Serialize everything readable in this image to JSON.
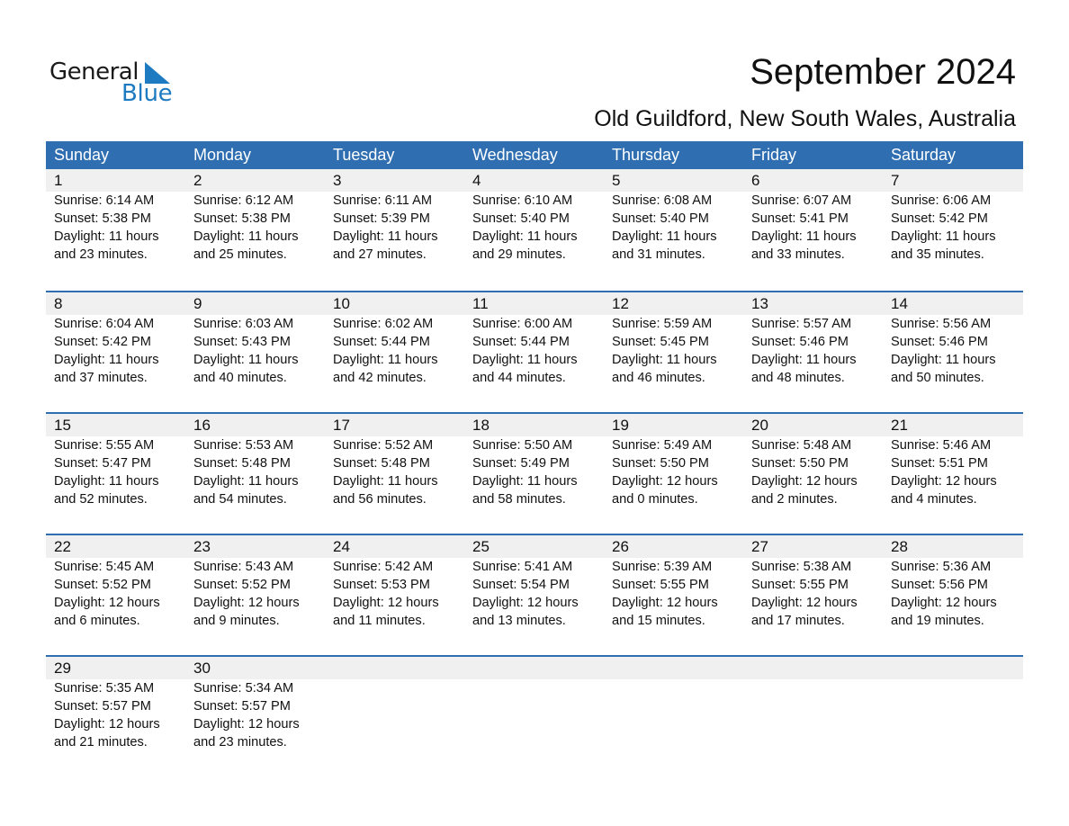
{
  "logo": {
    "word1": "General",
    "word2": "Blue",
    "icon": "triangle-flag-icon",
    "brand_color": "#1f7bc1"
  },
  "header": {
    "title": "September 2024",
    "location": "Old Guildford, New South Wales, Australia"
  },
  "colors": {
    "header_bg": "#2e6eb1",
    "date_strip_bg": "#f0f0f0"
  },
  "weekdays": [
    "Sunday",
    "Monday",
    "Tuesday",
    "Wednesday",
    "Thursday",
    "Friday",
    "Saturday"
  ],
  "weeks": [
    [
      {
        "day": "1",
        "sunrise": "Sunrise: 6:14 AM",
        "sunset": "Sunset: 5:38 PM",
        "daylight": "Daylight: 11 hours",
        "minutes": "and 23 minutes."
      },
      {
        "day": "2",
        "sunrise": "Sunrise: 6:12 AM",
        "sunset": "Sunset: 5:38 PM",
        "daylight": "Daylight: 11 hours",
        "minutes": "and 25 minutes."
      },
      {
        "day": "3",
        "sunrise": "Sunrise: 6:11 AM",
        "sunset": "Sunset: 5:39 PM",
        "daylight": "Daylight: 11 hours",
        "minutes": "and 27 minutes."
      },
      {
        "day": "4",
        "sunrise": "Sunrise: 6:10 AM",
        "sunset": "Sunset: 5:40 PM",
        "daylight": "Daylight: 11 hours",
        "minutes": "and 29 minutes."
      },
      {
        "day": "5",
        "sunrise": "Sunrise: 6:08 AM",
        "sunset": "Sunset: 5:40 PM",
        "daylight": "Daylight: 11 hours",
        "minutes": "and 31 minutes."
      },
      {
        "day": "6",
        "sunrise": "Sunrise: 6:07 AM",
        "sunset": "Sunset: 5:41 PM",
        "daylight": "Daylight: 11 hours",
        "minutes": "and 33 minutes."
      },
      {
        "day": "7",
        "sunrise": "Sunrise: 6:06 AM",
        "sunset": "Sunset: 5:42 PM",
        "daylight": "Daylight: 11 hours",
        "minutes": "and 35 minutes."
      }
    ],
    [
      {
        "day": "8",
        "sunrise": "Sunrise: 6:04 AM",
        "sunset": "Sunset: 5:42 PM",
        "daylight": "Daylight: 11 hours",
        "minutes": "and 37 minutes."
      },
      {
        "day": "9",
        "sunrise": "Sunrise: 6:03 AM",
        "sunset": "Sunset: 5:43 PM",
        "daylight": "Daylight: 11 hours",
        "minutes": "and 40 minutes."
      },
      {
        "day": "10",
        "sunrise": "Sunrise: 6:02 AM",
        "sunset": "Sunset: 5:44 PM",
        "daylight": "Daylight: 11 hours",
        "minutes": "and 42 minutes."
      },
      {
        "day": "11",
        "sunrise": "Sunrise: 6:00 AM",
        "sunset": "Sunset: 5:44 PM",
        "daylight": "Daylight: 11 hours",
        "minutes": "and 44 minutes."
      },
      {
        "day": "12",
        "sunrise": "Sunrise: 5:59 AM",
        "sunset": "Sunset: 5:45 PM",
        "daylight": "Daylight: 11 hours",
        "minutes": "and 46 minutes."
      },
      {
        "day": "13",
        "sunrise": "Sunrise: 5:57 AM",
        "sunset": "Sunset: 5:46 PM",
        "daylight": "Daylight: 11 hours",
        "minutes": "and 48 minutes."
      },
      {
        "day": "14",
        "sunrise": "Sunrise: 5:56 AM",
        "sunset": "Sunset: 5:46 PM",
        "daylight": "Daylight: 11 hours",
        "minutes": "and 50 minutes."
      }
    ],
    [
      {
        "day": "15",
        "sunrise": "Sunrise: 5:55 AM",
        "sunset": "Sunset: 5:47 PM",
        "daylight": "Daylight: 11 hours",
        "minutes": "and 52 minutes."
      },
      {
        "day": "16",
        "sunrise": "Sunrise: 5:53 AM",
        "sunset": "Sunset: 5:48 PM",
        "daylight": "Daylight: 11 hours",
        "minutes": "and 54 minutes."
      },
      {
        "day": "17",
        "sunrise": "Sunrise: 5:52 AM",
        "sunset": "Sunset: 5:48 PM",
        "daylight": "Daylight: 11 hours",
        "minutes": "and 56 minutes."
      },
      {
        "day": "18",
        "sunrise": "Sunrise: 5:50 AM",
        "sunset": "Sunset: 5:49 PM",
        "daylight": "Daylight: 11 hours",
        "minutes": "and 58 minutes."
      },
      {
        "day": "19",
        "sunrise": "Sunrise: 5:49 AM",
        "sunset": "Sunset: 5:50 PM",
        "daylight": "Daylight: 12 hours",
        "minutes": "and 0 minutes."
      },
      {
        "day": "20",
        "sunrise": "Sunrise: 5:48 AM",
        "sunset": "Sunset: 5:50 PM",
        "daylight": "Daylight: 12 hours",
        "minutes": "and 2 minutes."
      },
      {
        "day": "21",
        "sunrise": "Sunrise: 5:46 AM",
        "sunset": "Sunset: 5:51 PM",
        "daylight": "Daylight: 12 hours",
        "minutes": "and 4 minutes."
      }
    ],
    [
      {
        "day": "22",
        "sunrise": "Sunrise: 5:45 AM",
        "sunset": "Sunset: 5:52 PM",
        "daylight": "Daylight: 12 hours",
        "minutes": "and 6 minutes."
      },
      {
        "day": "23",
        "sunrise": "Sunrise: 5:43 AM",
        "sunset": "Sunset: 5:52 PM",
        "daylight": "Daylight: 12 hours",
        "minutes": "and 9 minutes."
      },
      {
        "day": "24",
        "sunrise": "Sunrise: 5:42 AM",
        "sunset": "Sunset: 5:53 PM",
        "daylight": "Daylight: 12 hours",
        "minutes": "and 11 minutes."
      },
      {
        "day": "25",
        "sunrise": "Sunrise: 5:41 AM",
        "sunset": "Sunset: 5:54 PM",
        "daylight": "Daylight: 12 hours",
        "minutes": "and 13 minutes."
      },
      {
        "day": "26",
        "sunrise": "Sunrise: 5:39 AM",
        "sunset": "Sunset: 5:55 PM",
        "daylight": "Daylight: 12 hours",
        "minutes": "and 15 minutes."
      },
      {
        "day": "27",
        "sunrise": "Sunrise: 5:38 AM",
        "sunset": "Sunset: 5:55 PM",
        "daylight": "Daylight: 12 hours",
        "minutes": "and 17 minutes."
      },
      {
        "day": "28",
        "sunrise": "Sunrise: 5:36 AM",
        "sunset": "Sunset: 5:56 PM",
        "daylight": "Daylight: 12 hours",
        "minutes": "and 19 minutes."
      }
    ],
    [
      {
        "day": "29",
        "sunrise": "Sunrise: 5:35 AM",
        "sunset": "Sunset: 5:57 PM",
        "daylight": "Daylight: 12 hours",
        "minutes": "and 21 minutes."
      },
      {
        "day": "30",
        "sunrise": "Sunrise: 5:34 AM",
        "sunset": "Sunset: 5:57 PM",
        "daylight": "Daylight: 12 hours",
        "minutes": "and 23 minutes."
      },
      null,
      null,
      null,
      null,
      null
    ]
  ]
}
